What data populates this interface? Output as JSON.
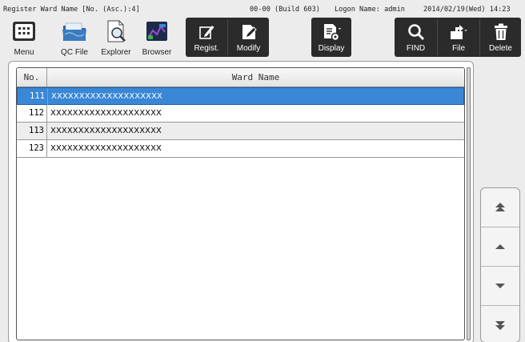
{
  "titlebar": {
    "window_title": "Register Ward Name [No. (Asc.):4]",
    "build": "00-00 (Build 603)",
    "logon": "Logon Name: admin",
    "datetime": "2014/02/19(Wed) 14:23"
  },
  "toolbar": {
    "menu": "Menu",
    "qc_file": "QC File",
    "explorer": "Explorer",
    "browser": "Browser",
    "regist": "Regist.",
    "modify": "Modify",
    "display": "Display",
    "find": "FIND",
    "file": "File",
    "delete": "Delete"
  },
  "grid": {
    "col_no": "No.",
    "col_ward": "Ward Name",
    "rows": [
      {
        "no": "111",
        "name": "XXXXXXXXXXXXXXXXXXXX",
        "selected": true
      },
      {
        "no": "112",
        "name": "XXXXXXXXXXXXXXXXXXXX",
        "selected": false
      },
      {
        "no": "113",
        "name": "XXXXXXXXXXXXXXXXXXXX",
        "selected": false
      },
      {
        "no": "123",
        "name": "XXXXXXXXXXXXXXXXXXXX",
        "selected": false
      }
    ]
  },
  "nav": {
    "icons": [
      "scroll-top-icon",
      "scroll-up-icon",
      "scroll-down-icon",
      "scroll-bottom-icon"
    ]
  },
  "colors": {
    "selection": "#3a87d6",
    "dark_toolbar": "#2b2b2b"
  }
}
